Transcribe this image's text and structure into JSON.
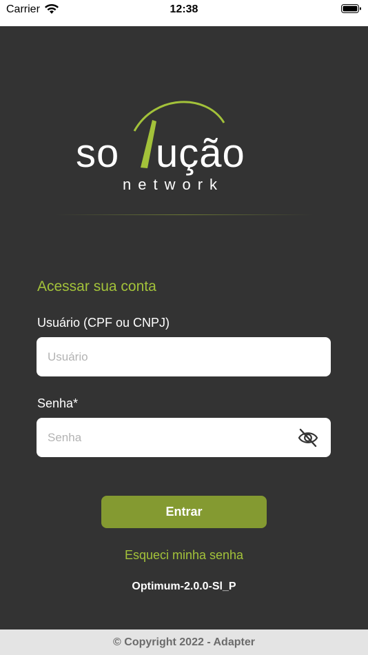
{
  "status_bar": {
    "carrier": "Carrier",
    "time": "12:38"
  },
  "logo": {
    "wordmark": "solução",
    "tagline": "network"
  },
  "colors": {
    "accent": "#a3c23a",
    "button": "#849a31",
    "background": "#333333"
  },
  "form": {
    "title": "Acessar sua conta",
    "user_label": "Usuário (CPF ou CNPJ)",
    "user_placeholder": "Usuário",
    "password_label": "Senha*",
    "password_placeholder": "Senha",
    "submit_label": "Entrar",
    "forgot_label": "Esqueci minha senha",
    "version": "Optimum-2.0.0-Sl_P"
  },
  "footer": {
    "copyright": "© Copyright 2022 - Adapter"
  }
}
